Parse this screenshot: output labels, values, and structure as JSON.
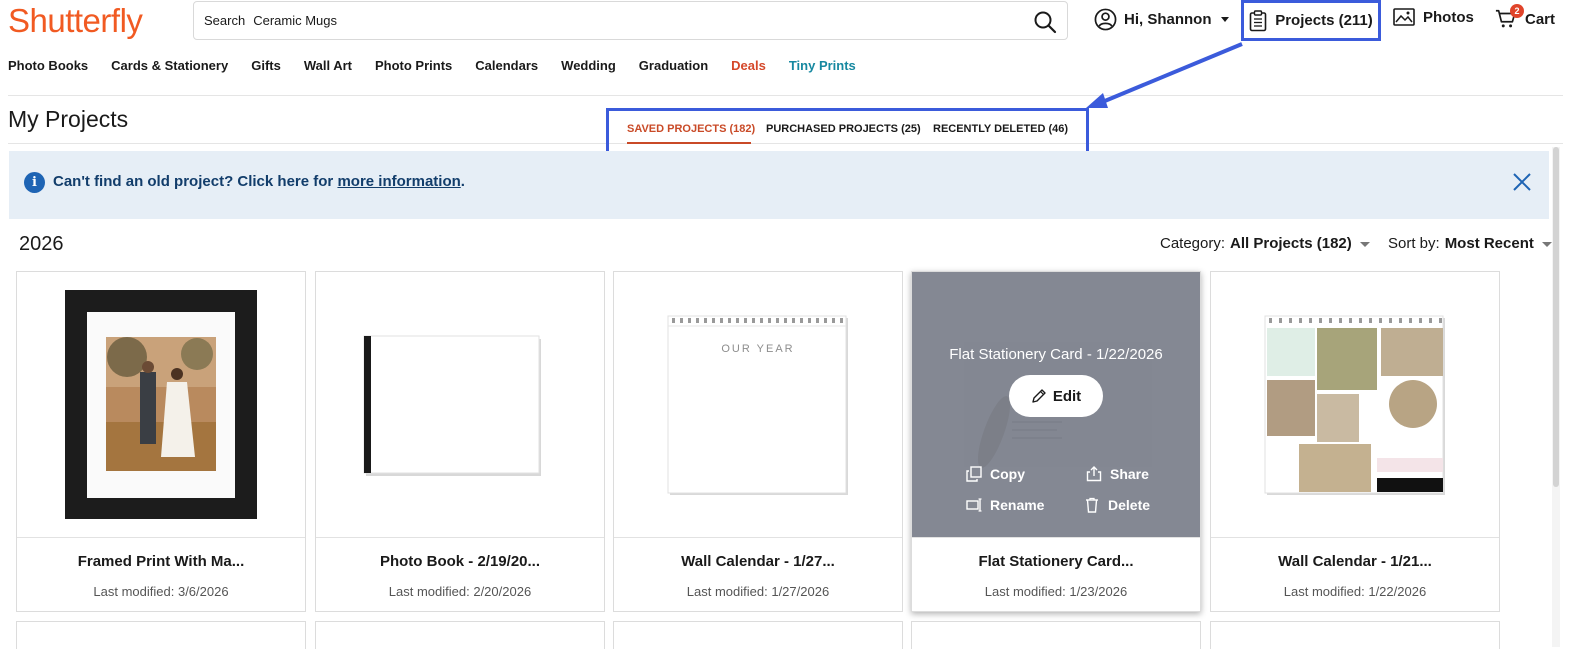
{
  "header": {
    "logo": "Shutterfly",
    "search_label": "Search",
    "search_value": "Ceramic Mugs",
    "user_greeting": "Hi, Shannon",
    "projects_label": "Projects (211)",
    "photos_label": "Photos",
    "cart_label": "Cart",
    "cart_count": "2"
  },
  "nav": [
    "Photo Books",
    "Cards & Stationery",
    "Gifts",
    "Wall Art",
    "Photo Prints",
    "Calendars",
    "Wedding",
    "Graduation",
    "Deals",
    "Tiny Prints"
  ],
  "page_title": "My Projects",
  "tabs": [
    {
      "label": "SAVED PROJECTS (182)",
      "active": true
    },
    {
      "label": "PURCHASED PROJECTS (25)",
      "active": false
    },
    {
      "label": "RECENTLY DELETED (46)",
      "active": false
    }
  ],
  "banner": {
    "text": "Can't find an old project? Click here for ",
    "link": "more information",
    "suffix": "."
  },
  "year": "2026",
  "filters": {
    "category_label": "Category:",
    "category_value": "All Projects (182)",
    "sort_label": "Sort by:",
    "sort_value": "Most Recent"
  },
  "cards": [
    {
      "name": "Framed Print With Ma...",
      "date": "Last modified: 3/6/2026"
    },
    {
      "name": "Photo Book - 2/19/20...",
      "date": "Last modified: 2/20/2026"
    },
    {
      "name": "Wall Calendar - 1/27...",
      "date": "Last modified: 1/27/2026",
      "cover_text": "OUR YEAR"
    },
    {
      "name": "Flat Stationery Card...",
      "date": "Last modified: 1/23/2026",
      "hover_title": "Flat Stationery Card - 1/22/2026"
    },
    {
      "name": "Wall Calendar - 1/21...",
      "date": "Last modified: 1/22/2026"
    }
  ],
  "overlay_actions": {
    "edit": "Edit",
    "copy": "Copy",
    "share": "Share",
    "rename": "Rename",
    "delete": "Delete"
  },
  "colors": {
    "brand": "#f15a22",
    "annotation": "#3b5bdb",
    "active_tab": "#c94a27",
    "banner_bg": "#e6eef6",
    "info": "#1e64b4"
  }
}
